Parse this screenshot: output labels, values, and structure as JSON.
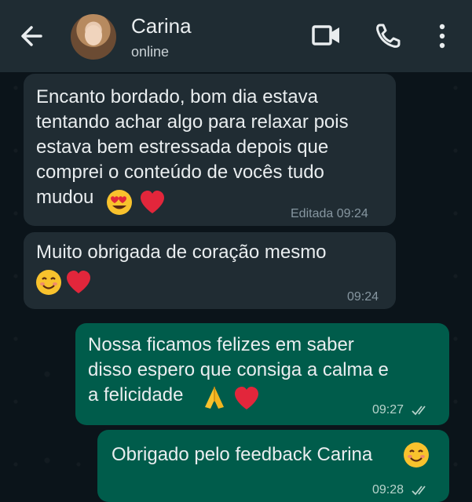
{
  "header": {
    "contact_name": "Carina",
    "status": "online",
    "icons": [
      "back-arrow-icon",
      "video-call-icon",
      "phone-call-icon",
      "more-options-icon"
    ]
  },
  "messages": [
    {
      "direction": "incoming",
      "text": "Encanto bordado, bom dia estava\ntentando achar algo para relaxar pois\nestava bem estressada depois que\ncomprei o conteúdo de vocês tudo\nmudou",
      "emojis": [
        "heart-eyes-emoji",
        "red-heart-emoji"
      ],
      "edited_label": "Editada",
      "time": "09:24"
    },
    {
      "direction": "incoming",
      "text": "Muito obrigada de coração mesmo",
      "emojis": [
        "smiling-face-emoji",
        "red-heart-emoji"
      ],
      "time": "09:24"
    },
    {
      "direction": "outgoing",
      "text": "Nossa ficamos felizes em saber\ndisso espero que consiga a calma e\na felicidade",
      "emojis": [
        "folded-hands-emoji",
        "red-heart-emoji"
      ],
      "time": "09:27",
      "status": "read-double-check"
    },
    {
      "direction": "outgoing",
      "text": "Obrigado pelo feedback Carina",
      "emojis": [
        "smiling-face-emoji"
      ],
      "time": "09:28",
      "status": "read-double-check"
    }
  ],
  "colors": {
    "header_bg": "#1f2c33",
    "chat_bg": "#0b141a",
    "incoming_bubble": "#202c33",
    "outgoing_bubble": "#005c4b",
    "meta_text": "#8696a0"
  }
}
